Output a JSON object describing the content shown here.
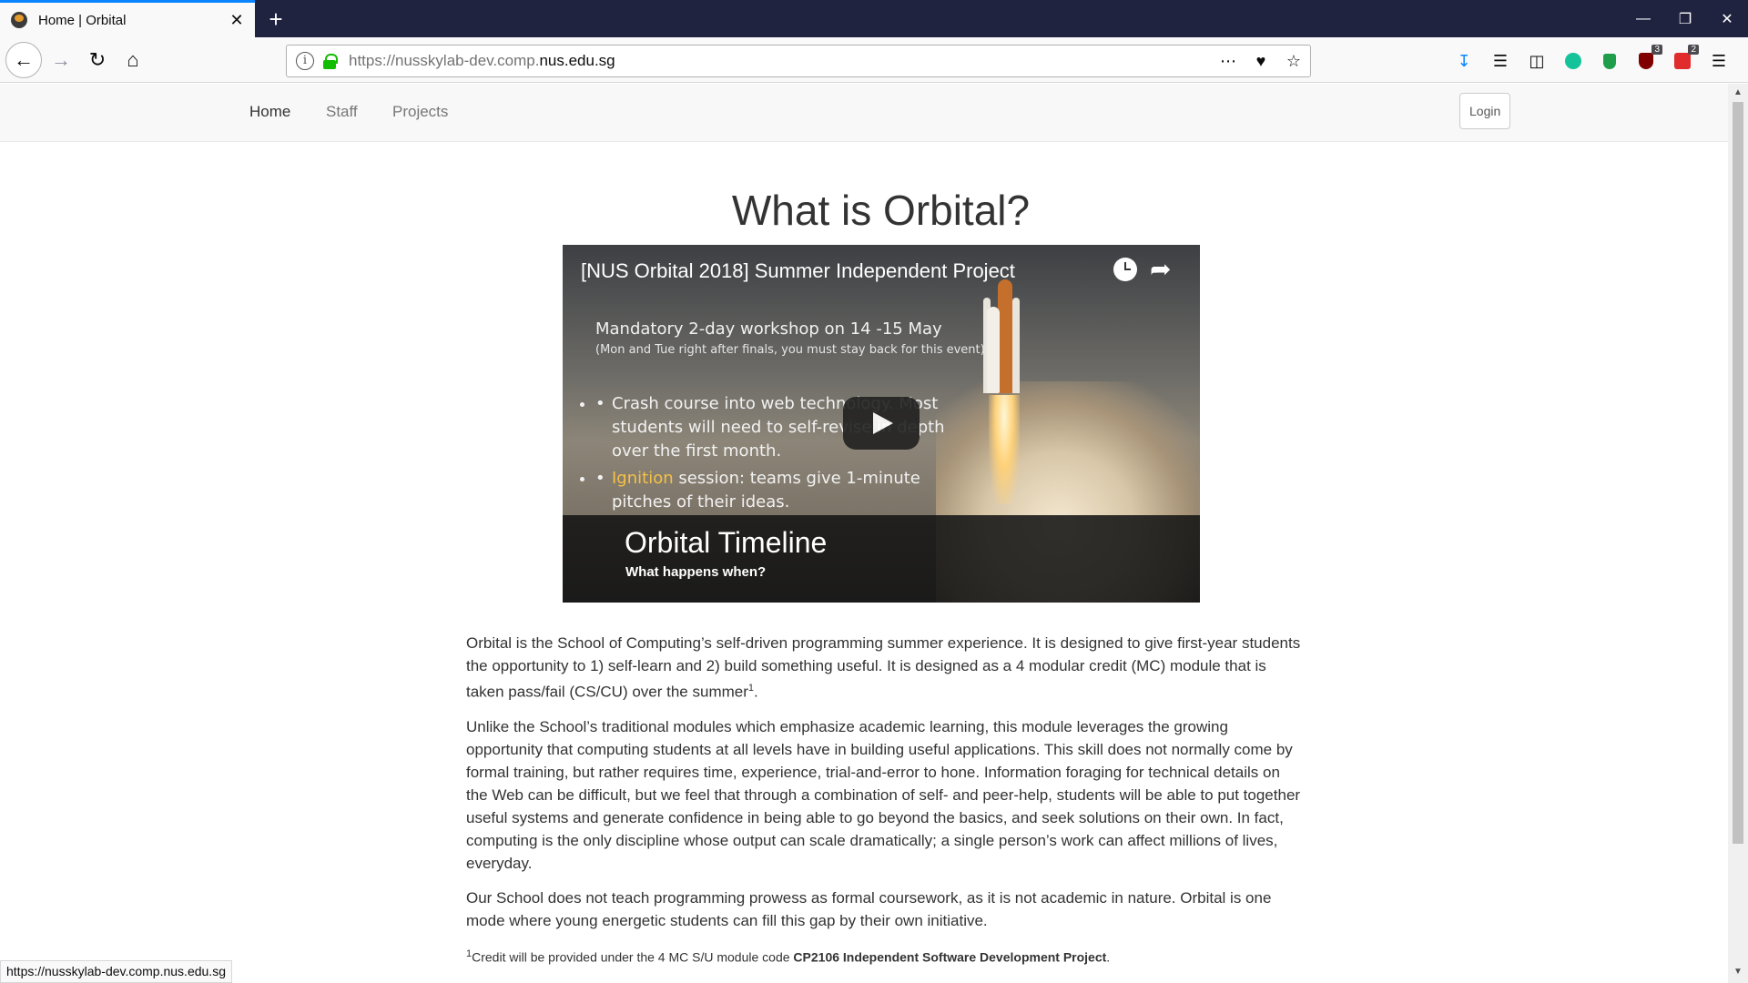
{
  "browser": {
    "tab_title": "Home | Orbital",
    "tab_close": "✕",
    "new_tab": "+",
    "url_prefix": "https://nusskylab-dev.comp.",
    "url_domain": "nus.edu.sg",
    "badges": {
      "ublock": "3",
      "ext": "2"
    },
    "status_url": "https://nusskylab-dev.comp.nus.edu.sg"
  },
  "site_nav": {
    "items": [
      "Home",
      "Staff",
      "Projects"
    ],
    "login": "Login"
  },
  "page": {
    "title": "What is Orbital?",
    "video": {
      "title": "[NUS Orbital 2018] Summer Independent Project",
      "slide_line1": "Mandatory 2-day workshop on 14 -15 May",
      "slide_line2": "(Mon and Tue right after finals, you must stay back for this event)",
      "bullet1": "Crash course into web technology. Most students will need to self-revise in depth over the first month.",
      "bullet2_hl": "Ignition",
      "bullet2_rest": " session: teams give 1-minute pitches of their ideas.",
      "band_title": "Orbital Timeline",
      "band_subtitle": "What happens when?"
    },
    "para1": "Orbital is the School of Computing’s self-driven programming summer experience. It is designed to give first-year students the opportunity to 1) self-learn and 2) build something useful. It is designed as a 4 modular credit (MC) module that is taken pass/fail (CS/CU) over the summer",
    "para1_sup": "1",
    "para1_end": ".",
    "para2": "Unlike the School’s traditional modules which emphasize academic learning, this module leverages the growing opportunity that computing students at all levels have in building useful applications. This skill does not normally come by formal training, but rather requires time, experience, trial-and-error to hone. Information foraging for technical details on the Web can be difficult, but we feel that through a combination of self- and peer-help, students will be able to put together useful systems and generate confidence in being able to go beyond the basics, and seek solutions on their own. In fact, computing is the only discipline whose output can scale dramatically; a single person’s work can affect millions of lives, everyday.",
    "para3": "Our School does not teach programming prowess as formal coursework, as it is not academic in nature. Orbital is one mode where young energetic students can fill this gap by their own initiative.",
    "footnote_sup": "1",
    "footnote_text": "Credit will be provided under the 4 MC S/U module code ",
    "footnote_bold": "CP2106 Independent Software Development Project",
    "footnote_end": "."
  }
}
